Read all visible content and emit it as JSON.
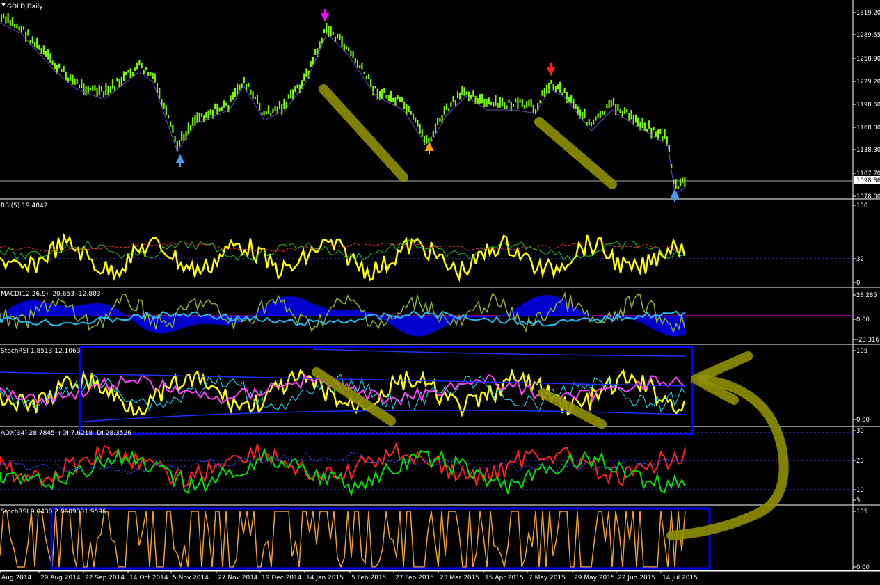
{
  "chart": {
    "symbol_title": "GOLD,Daily",
    "current_price": "1098.36",
    "x_axis_labels": [
      "Aug 2014",
      "29 Aug 2014",
      "22 Sep 2014",
      "14 Oct 2014",
      "5 Nov 2014",
      "27 Nov 2014",
      "19 Dec 2014",
      "14 Jan 2015",
      "5 Feb 2015",
      "27 Feb 2015",
      "23 Mar 2015",
      "15 Apr 2015",
      "7 May 2015",
      "29 May 2015",
      "22 Jun 2015",
      "14 Jul 2015"
    ]
  },
  "panes": [
    {
      "id": "price",
      "label": "GOLD,Daily",
      "ticks": [
        "1319.20",
        "1289.55",
        "1258.90",
        "1229.20",
        "1198.60",
        "1168.00",
        "1138.30",
        "1107.70",
        "1078.00"
      ],
      "highlight": "1098.36"
    },
    {
      "id": "rsi",
      "label": "RSI(5) 19.4842",
      "ticks": [
        "100",
        "32",
        "0"
      ]
    },
    {
      "id": "macd",
      "label": "MACD(12,26,9) -20.653 -12.803",
      "ticks": [
        "28.285",
        "0.00",
        "-23.316"
      ]
    },
    {
      "id": "stochrsi1",
      "label": "StochRSI 1.8513 12.1063",
      "ticks": [
        "105",
        "0.00"
      ]
    },
    {
      "id": "adx",
      "label": "ADX(34) 28.7845 +DI 7.6218 -DI 28.3526",
      "ticks": [
        "30",
        "20",
        "10",
        "5"
      ]
    },
    {
      "id": "stochrsi2",
      "label": "StochRSI 9.0430 2.8609301.9596",
      "ticks": [
        "105",
        "0.00"
      ]
    }
  ],
  "colors": {
    "background": "#000000",
    "candles": "#7cfc00",
    "rsi": "#ffff00",
    "macd_hist": "#0000ff",
    "macd_line": "#8db23a",
    "adx_plus": "#00e000",
    "adx_minus": "#ff2020",
    "stoch2": "#f0a030",
    "annotation": "#8f8f00",
    "box": "#0000ff"
  },
  "arrows": [
    {
      "name": "magenta-down-arrow",
      "color": "#ff00ff",
      "dir": "down"
    },
    {
      "name": "red-down-arrow",
      "color": "#ff2020",
      "dir": "down"
    },
    {
      "name": "blue-up-arrow-left",
      "color": "#3fa0ff",
      "dir": "up"
    },
    {
      "name": "orange-up-arrow",
      "color": "#ff9900",
      "dir": "up"
    },
    {
      "name": "blue-up-arrow-right",
      "color": "#3fa0ff",
      "dir": "up"
    }
  ]
}
